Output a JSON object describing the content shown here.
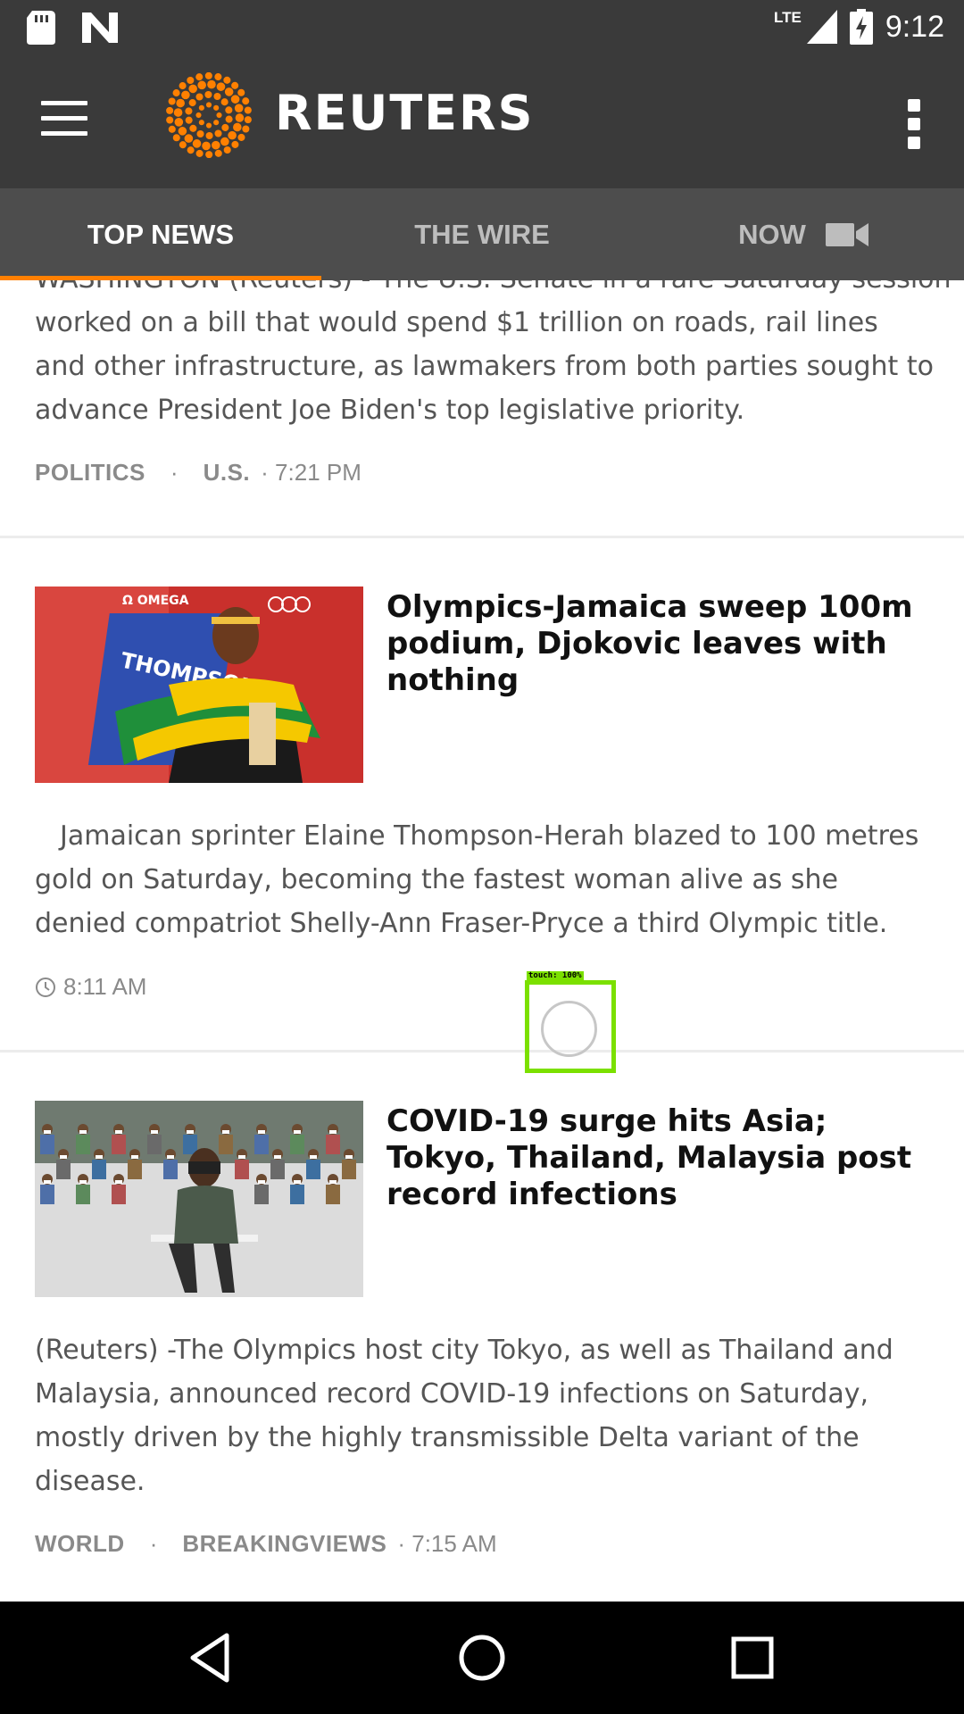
{
  "status_bar": {
    "time": "9:12",
    "network": "LTE",
    "icons": [
      "sd-card-icon",
      "n-notification-icon",
      "signal-icon",
      "battery-charging-icon"
    ]
  },
  "app_bar": {
    "brand": "REUTERS",
    "icons": [
      "hamburger-menu-icon",
      "reuters-logo-icon",
      "overflow-menu-icon"
    ],
    "colors": {
      "background": "#3a3a3a",
      "logo": "#ff8000"
    }
  },
  "tabs": [
    {
      "label": "TOP NEWS",
      "active": true
    },
    {
      "label": "THE WIRE",
      "active": false
    },
    {
      "label": "NOW",
      "active": false,
      "icon": "video-camera-icon"
    }
  ],
  "accent_color": "#ff8000",
  "articles": [
    {
      "partial_first_line": "WASHINGTON (Reuters) - The U.S. Senate in a rare Saturday session",
      "summary": "worked on a bill that would spend $1 trillion on roads, rail lines and other infrastructure, as lawmakers from both parties sought to advance President Joe Biden's top legislative priority.",
      "categories": [
        "POLITICS",
        "U.S."
      ],
      "time": "7:21 PM"
    },
    {
      "headline": "Olympics-Jamaica sweep 100m podium, Djokovic leaves with nothing",
      "summary": "Jamaican sprinter Elaine Thompson-Herah blazed to 100 metres gold on Saturday, becoming the fastest woman alive as she denied compatriot Shelly-Ann Fraser-Pryce a third Olympic title.",
      "time": "8:11 AM",
      "image_banner_text": "THOMPSON-H"
    },
    {
      "headline": "COVID-19 surge hits Asia; Tokyo, Thailand, Malaysia post record infections",
      "summary": "(Reuters) -The Olympics host city Tokyo, as well as Thailand and Malaysia, announced record COVID-19 infections on Saturday, mostly driven by the highly transmissible Delta variant of the disease.",
      "categories": [
        "WORLD",
        "BREAKINGVIEWS"
      ],
      "time": "7:15 AM"
    }
  ],
  "touch_overlay": {
    "label": "touch: 100%"
  },
  "nav_bar": {
    "icons": [
      "back-icon",
      "home-icon",
      "recents-icon"
    ]
  }
}
